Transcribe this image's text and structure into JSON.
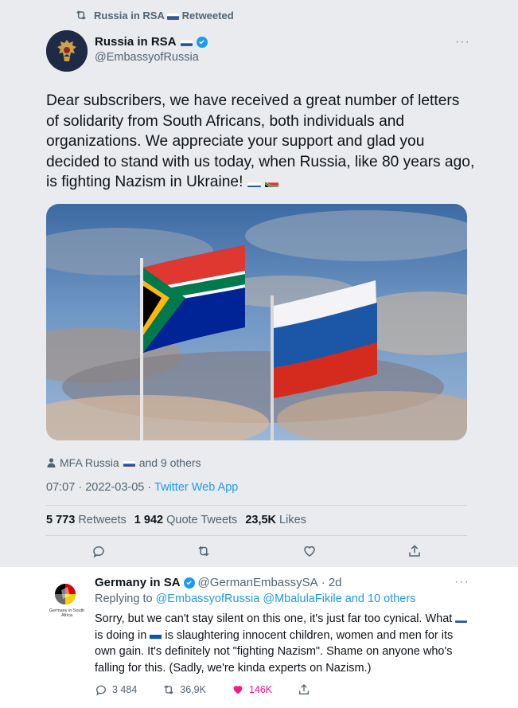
{
  "retweet_banner": {
    "text": "Russia in RSA",
    "suffix": "Retweeted"
  },
  "tweet": {
    "author_name": "Russia in RSA",
    "author_handle": "@EmbassyofRussia",
    "more_label": "···",
    "text": "Dear subscribers, we have received a great number of letters of solidarity from South Africans, both individuals and organizations. We appreciate your support and glad you decided to stand with us today, when Russia, like 80 years ago, is fighting Nazism in Ukraine!",
    "liked_by": {
      "name": "MFA Russia",
      "suffix": "and 9 others"
    },
    "time": "07:07",
    "date": "2022-03-05",
    "separator": "·",
    "app": "Twitter Web App",
    "stats": {
      "retweets_count": "5 773",
      "retweets_label": "Retweets",
      "quotes_count": "1 942",
      "quotes_label": "Quote Tweets",
      "likes_count": "23,5K",
      "likes_label": "Likes"
    }
  },
  "reply": {
    "author_name": "Germany in SA",
    "author_handle": "@GermanEmbassySA",
    "age": "· 2d",
    "avatar_caption": "Germany in South Africa",
    "replying_prefix": "Replying to",
    "replying_mentions": "@EmbassyofRussia @MbalulaFikile and 10 others",
    "text_part1": "Sorry, but we can't stay silent on this one, it's just far too cynical. What",
    "text_part2": "is doing in",
    "text_part3": "is slaughtering innocent children, women and men for its own gain. It's definitely not \"fighting Nazism\". Shame on anyone who's falling for this. (Sadly, we're kinda experts on Nazism.)",
    "more_label": "···",
    "counts": {
      "replies": "3 484",
      "retweets": "36,9K",
      "likes": "146K"
    }
  },
  "colors": {
    "link": "#1d9bf0",
    "like": "#f91880",
    "muted": "#536471",
    "background": "#e9ebee"
  },
  "icons": [
    "retweet-icon",
    "verified-icon",
    "reply-icon",
    "like-icon",
    "share-icon",
    "person-icon",
    "more-icon",
    "flag-russia-icon",
    "flag-south-africa-icon",
    "flag-ukraine-icon"
  ]
}
